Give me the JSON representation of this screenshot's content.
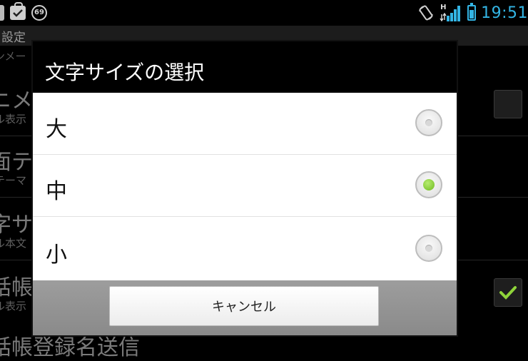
{
  "status_bar": {
    "notification_badge": "69",
    "network_type": "H",
    "time": "19:51",
    "icons": [
      "clip-icon",
      "shopping-bag-check-icon",
      "notification-badge-icon",
      "screen-rotation-icon",
      "signal-icon",
      "battery-icon"
    ]
  },
  "background": {
    "header_title": "設定",
    "items": [
      {
        "title": "",
        "subtitle": "ンメー",
        "checkbox": null
      },
      {
        "title": "ニメ",
        "subtitle": "ル表示",
        "checkbox": "unchecked"
      },
      {
        "title": "面テ",
        "subtitle": "テーマ",
        "checkbox": null
      },
      {
        "title": "字サ",
        "subtitle": "ル本文",
        "checkbox": null
      },
      {
        "title": "話帳",
        "subtitle": "ル表示",
        "checkbox": "checked"
      },
      {
        "title": "話帳登録名送信",
        "subtitle": "",
        "checkbox": null
      }
    ]
  },
  "dialog": {
    "title": "文字サイズの選択",
    "options": [
      {
        "label": "大",
        "selected": false
      },
      {
        "label": "中",
        "selected": true
      },
      {
        "label": "小",
        "selected": false
      }
    ],
    "cancel_label": "キャンセル"
  },
  "colors": {
    "accent_blue": "#33b5e5",
    "radio_selected_green": "#8fd43a",
    "checkbox_check_green": "#8fd43a"
  }
}
